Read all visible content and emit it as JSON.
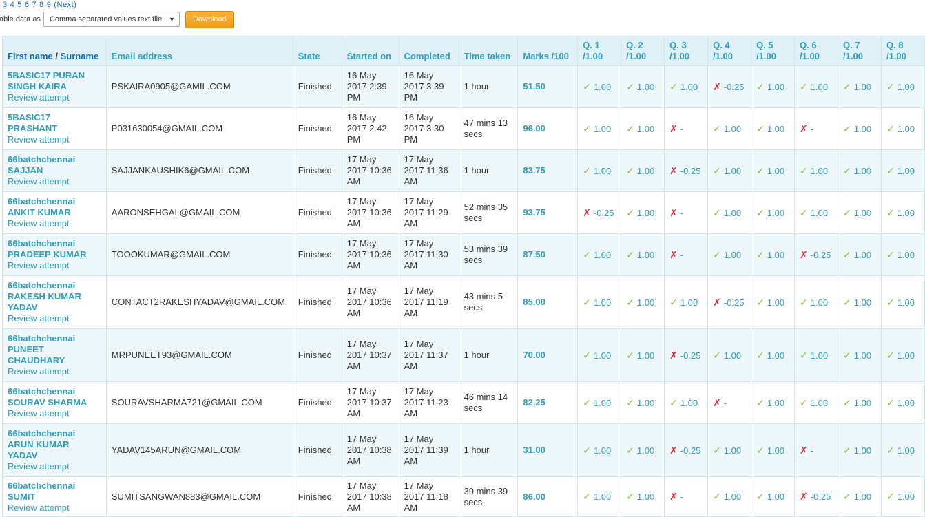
{
  "paging": {
    "pages": [
      "3",
      "4",
      "5",
      "6",
      "7",
      "8",
      "9"
    ],
    "next": "(Next)"
  },
  "download": {
    "label": "able data as",
    "format_selected": "Comma separated values text file",
    "button": "Download"
  },
  "table": {
    "headers": {
      "first_name": "First name",
      "separator": "/",
      "surname": "Surname",
      "email": "Email address",
      "state": "State",
      "started": "Started on",
      "completed": "Completed",
      "time": "Time taken",
      "marks": "Marks /100",
      "questions": [
        {
          "q": "Q. 1",
          "max": "/1.00"
        },
        {
          "q": "Q. 2",
          "max": "/1.00"
        },
        {
          "q": "Q. 3",
          "max": "/1.00"
        },
        {
          "q": "Q. 4",
          "max": "/1.00"
        },
        {
          "q": "Q. 5",
          "max": "/1.00"
        },
        {
          "q": "Q. 6",
          "max": "/1.00"
        },
        {
          "q": "Q. 7",
          "max": "/1.00"
        },
        {
          "q": "Q. 8",
          "max": "/1.00"
        }
      ]
    },
    "review_label": "Review attempt",
    "rows": [
      {
        "inst": "5BASIC17",
        "name": "PURAN SINGH KAIRA",
        "email": "PSKAIRA0905@GAMIL.COM",
        "state": "Finished",
        "started": "16 May 2017 2:39 PM",
        "completed": "16 May 2017 3:39 PM",
        "time": "1 hour",
        "marks": "51.50",
        "q": [
          {
            "s": "ok",
            "v": "1.00"
          },
          {
            "s": "ok",
            "v": "1.00"
          },
          {
            "s": "ok",
            "v": "1.00"
          },
          {
            "s": "bad",
            "v": "-0.25"
          },
          {
            "s": "ok",
            "v": "1.00"
          },
          {
            "s": "ok",
            "v": "1.00"
          },
          {
            "s": "ok",
            "v": "1.00"
          },
          {
            "s": "ok",
            "v": "1.00"
          }
        ]
      },
      {
        "inst": "5BASIC17",
        "name": "PRASHANT",
        "email": "P031630054@GMAIL.COM",
        "state": "Finished",
        "started": "16 May 2017 2:42 PM",
        "completed": "16 May 2017 3:30 PM",
        "time": "47 mins 13 secs",
        "marks": "96.00",
        "q": [
          {
            "s": "ok",
            "v": "1.00"
          },
          {
            "s": "ok",
            "v": "1.00"
          },
          {
            "s": "bad",
            "v": "-"
          },
          {
            "s": "ok",
            "v": "1.00"
          },
          {
            "s": "ok",
            "v": "1.00"
          },
          {
            "s": "bad",
            "v": "-"
          },
          {
            "s": "ok",
            "v": "1.00"
          },
          {
            "s": "ok",
            "v": "1.00"
          }
        ]
      },
      {
        "inst": "66batchchennai",
        "name": "SAJJAN",
        "email": "SAJJANKAUSHIK6@GMAIL.COM",
        "state": "Finished",
        "started": "17 May 2017 10:36 AM",
        "completed": "17 May 2017 11:36 AM",
        "time": "1 hour",
        "marks": "83.75",
        "q": [
          {
            "s": "ok",
            "v": "1.00"
          },
          {
            "s": "ok",
            "v": "1.00"
          },
          {
            "s": "bad",
            "v": "-0.25"
          },
          {
            "s": "ok",
            "v": "1.00"
          },
          {
            "s": "ok",
            "v": "1.00"
          },
          {
            "s": "ok",
            "v": "1.00"
          },
          {
            "s": "ok",
            "v": "1.00"
          },
          {
            "s": "ok",
            "v": "1.00"
          }
        ]
      },
      {
        "inst": "66batchchennai",
        "name": "ANKIT KUMAR",
        "email": "AARONSEHGAL@GMAIL.COM",
        "state": "Finished",
        "started": "17 May 2017 10:36 AM",
        "completed": "17 May 2017 11:29 AM",
        "time": "52 mins 35 secs",
        "marks": "93.75",
        "q": [
          {
            "s": "bad",
            "v": "-0.25"
          },
          {
            "s": "ok",
            "v": "1.00"
          },
          {
            "s": "bad",
            "v": "-"
          },
          {
            "s": "ok",
            "v": "1.00"
          },
          {
            "s": "ok",
            "v": "1.00"
          },
          {
            "s": "ok",
            "v": "1.00"
          },
          {
            "s": "ok",
            "v": "1.00"
          },
          {
            "s": "ok",
            "v": "1.00"
          }
        ]
      },
      {
        "inst": "66batchchennai",
        "name": "PRADEEP KUMAR",
        "email": "TOOOKUMAR@GMAIL.COM",
        "state": "Finished",
        "started": "17 May 2017 10:36 AM",
        "completed": "17 May 2017 11:30 AM",
        "time": "53 mins 39 secs",
        "marks": "87.50",
        "q": [
          {
            "s": "ok",
            "v": "1.00"
          },
          {
            "s": "ok",
            "v": "1.00"
          },
          {
            "s": "bad",
            "v": "-"
          },
          {
            "s": "ok",
            "v": "1.00"
          },
          {
            "s": "ok",
            "v": "1.00"
          },
          {
            "s": "bad",
            "v": "-0.25"
          },
          {
            "s": "ok",
            "v": "1.00"
          },
          {
            "s": "ok",
            "v": "1.00"
          }
        ]
      },
      {
        "inst": "66batchchennai",
        "name": "RAKESH KUMAR YADAV",
        "email": "CONTACT2RAKESHYADAV@GMAIL.COM",
        "state": "Finished",
        "started": "17 May 2017 10:36 AM",
        "completed": "17 May 2017 11:19 AM",
        "time": "43 mins 5 secs",
        "marks": "85.00",
        "q": [
          {
            "s": "ok",
            "v": "1.00"
          },
          {
            "s": "ok",
            "v": "1.00"
          },
          {
            "s": "ok",
            "v": "1.00"
          },
          {
            "s": "bad",
            "v": "-0.25"
          },
          {
            "s": "ok",
            "v": "1.00"
          },
          {
            "s": "ok",
            "v": "1.00"
          },
          {
            "s": "ok",
            "v": "1.00"
          },
          {
            "s": "ok",
            "v": "1.00"
          }
        ]
      },
      {
        "inst": "66batchchennai",
        "name": "PUNEET CHAUDHARY",
        "email": "MRPUNEET93@GMAIL.COM",
        "state": "Finished",
        "started": "17 May 2017 10:37 AM",
        "completed": "17 May 2017 11:37 AM",
        "time": "1 hour",
        "marks": "70.00",
        "q": [
          {
            "s": "ok",
            "v": "1.00"
          },
          {
            "s": "ok",
            "v": "1.00"
          },
          {
            "s": "bad",
            "v": "-0.25"
          },
          {
            "s": "ok",
            "v": "1.00"
          },
          {
            "s": "ok",
            "v": "1.00"
          },
          {
            "s": "ok",
            "v": "1.00"
          },
          {
            "s": "ok",
            "v": "1.00"
          },
          {
            "s": "ok",
            "v": "1.00"
          }
        ]
      },
      {
        "inst": "66batchchennai",
        "name": "SOURAV SHARMA",
        "email": "SOURAVSHARMA721@GMAIL.COM",
        "state": "Finished",
        "started": "17 May 2017 10:37 AM",
        "completed": "17 May 2017 11:23 AM",
        "time": "46 mins 14 secs",
        "marks": "82.25",
        "q": [
          {
            "s": "ok",
            "v": "1.00"
          },
          {
            "s": "ok",
            "v": "1.00"
          },
          {
            "s": "ok",
            "v": "1.00"
          },
          {
            "s": "bad",
            "v": "-"
          },
          {
            "s": "ok",
            "v": "1.00"
          },
          {
            "s": "ok",
            "v": "1.00"
          },
          {
            "s": "ok",
            "v": "1.00"
          },
          {
            "s": "ok",
            "v": "1.00"
          }
        ]
      },
      {
        "inst": "66batchchennai",
        "name": "ARUN KUMAR YADAV",
        "email": "YADAV145ARUN@GMAIL.COM",
        "state": "Finished",
        "started": "17 May 2017 10:38 AM",
        "completed": "17 May 2017 11:39 AM",
        "time": "1 hour",
        "marks": "31.00",
        "q": [
          {
            "s": "ok",
            "v": "1.00"
          },
          {
            "s": "ok",
            "v": "1.00"
          },
          {
            "s": "bad",
            "v": "-0.25"
          },
          {
            "s": "ok",
            "v": "1.00"
          },
          {
            "s": "ok",
            "v": "1.00"
          },
          {
            "s": "bad",
            "v": "-"
          },
          {
            "s": "ok",
            "v": "1.00"
          },
          {
            "s": "ok",
            "v": "1.00"
          }
        ]
      },
      {
        "inst": "66batchchennai",
        "name": "SUMIT",
        "email": "SUMITSANGWAN883@GMAIL.COM",
        "state": "Finished",
        "started": "17 May 2017 10:38 AM",
        "completed": "17 May 2017 11:18 AM",
        "time": "39 mins 39 secs",
        "marks": "86.00",
        "q": [
          {
            "s": "ok",
            "v": "1.00"
          },
          {
            "s": "ok",
            "v": "1.00"
          },
          {
            "s": "bad",
            "v": "-"
          },
          {
            "s": "ok",
            "v": "1.00"
          },
          {
            "s": "ok",
            "v": "1.00"
          },
          {
            "s": "bad",
            "v": "-0.25"
          },
          {
            "s": "ok",
            "v": "1.00"
          },
          {
            "s": "ok",
            "v": "1.00"
          }
        ]
      }
    ]
  },
  "colors": {
    "link": "#2f9fc1",
    "correct": "#87c23b",
    "incorrect": "#e0283b",
    "header_bg": "#dff0f6",
    "row_alt_bg": "#eef7fa",
    "button": "#f6a623"
  },
  "icons": {
    "correct": "check-icon",
    "incorrect": "cross-icon"
  }
}
